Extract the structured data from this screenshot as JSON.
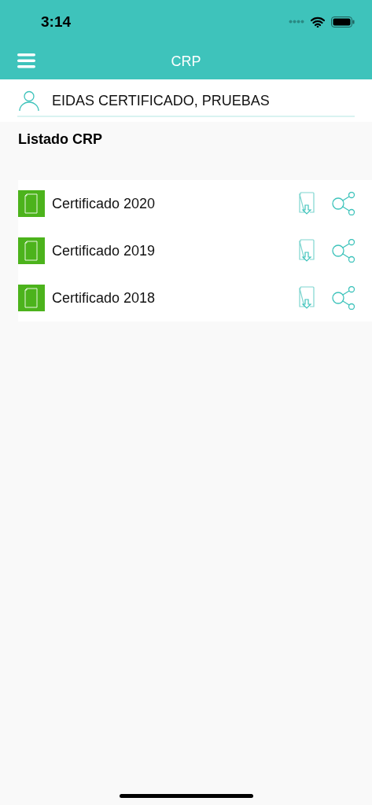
{
  "status_bar": {
    "time": "3:14"
  },
  "nav_bar": {
    "title": "CRP"
  },
  "user": {
    "name": "EIDAS CERTIFICADO, PRUEBAS"
  },
  "section": {
    "title": "Listado CRP"
  },
  "certificates": [
    {
      "name": "Certificado 2020"
    },
    {
      "name": "Certificado 2019"
    },
    {
      "name": "Certificado 2018"
    }
  ]
}
